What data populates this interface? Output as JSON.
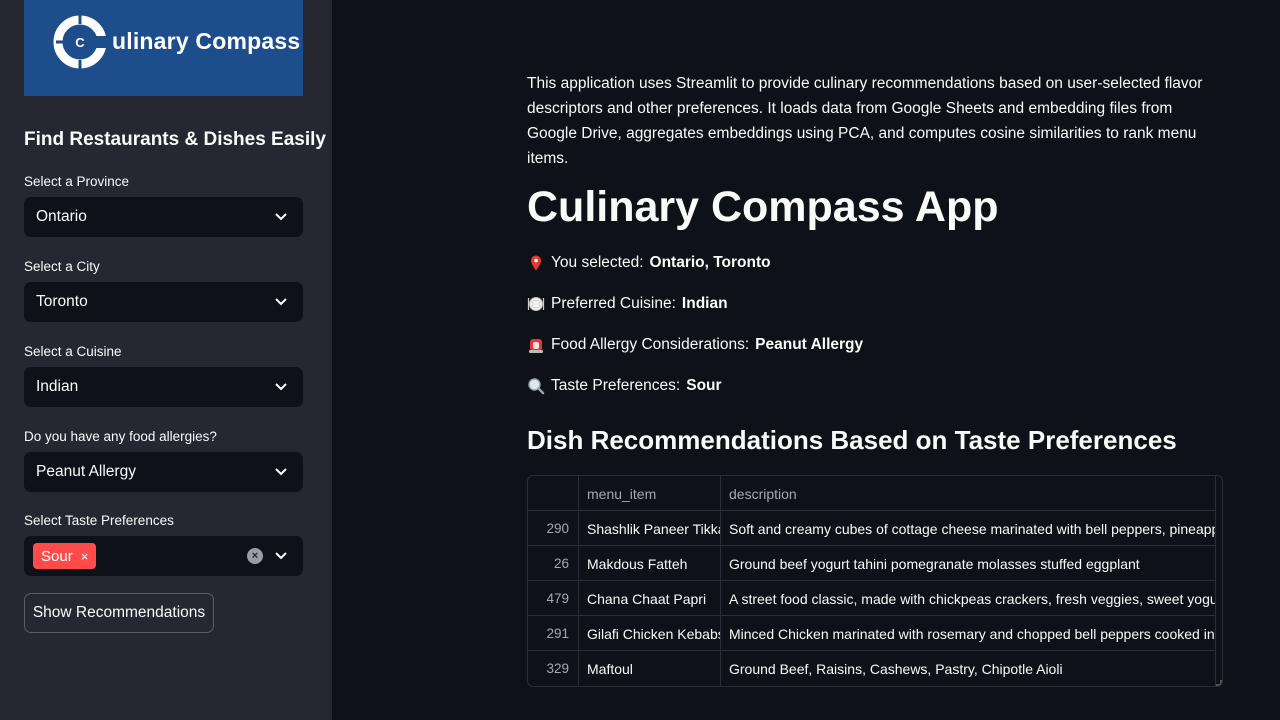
{
  "sidebar": {
    "logo_text": "ulinary Compass",
    "logo_mark_letter": "C",
    "heading": "Find Restaurants & Dishes Easily",
    "province": {
      "label": "Select a Province",
      "value": "Ontario"
    },
    "city": {
      "label": "Select a City",
      "value": "Toronto"
    },
    "cuisine": {
      "label": "Select a Cuisine",
      "value": "Indian"
    },
    "allergy": {
      "label": "Do you have any food allergies?",
      "value": "Peanut Allergy"
    },
    "taste": {
      "label": "Select Taste Preferences",
      "tags": [
        "Sour"
      ],
      "tag_remove": "×",
      "clear": "×"
    },
    "button_label": "Show Recommendations"
  },
  "main": {
    "intro": "This application uses Streamlit to provide culinary recommendations based on user-selected flavor descriptors and other preferences. It loads data from Google Sheets and embedding files from Google Drive, aggregates embeddings using PCA, and computes cosine similarities to rank menu items.",
    "title": "Culinary Compass App",
    "location": {
      "label": "You selected:",
      "value": "Ontario, Toronto",
      "icon": "pin-icon"
    },
    "cuisine": {
      "label": "Preferred Cuisine:",
      "value": "Indian",
      "icon": "plate-icon"
    },
    "allergy": {
      "label": "Food Allergy Considerations:",
      "value": "Peanut Allergy",
      "icon": "siren-icon"
    },
    "taste": {
      "label": "Taste Preferences:",
      "value": "Sour",
      "icon": "magnifier-icon"
    },
    "subtitle": "Dish Recommendations Based on Taste Preferences",
    "table": {
      "columns": [
        "",
        "menu_item",
        "description"
      ],
      "rows": [
        {
          "idx": "290",
          "menu_item": "Shashlik Paneer Tikka",
          "description": "Soft and creamy cubes of cottage cheese marinated with bell peppers, pineapples, or"
        },
        {
          "idx": "26",
          "menu_item": "Makdous Fatteh",
          "description": "Ground beef yogurt tahini pomegranate molasses stuffed eggplant"
        },
        {
          "idx": "479",
          "menu_item": "Chana Chaat Papri",
          "description": "A street food classic, made with chickpeas crackers, fresh veggies, sweet yogurt and t"
        },
        {
          "idx": "291",
          "menu_item": "Gilafi Chicken Kebabs",
          "description": "Minced Chicken marinated with rosemary and chopped bell peppers cooked in the cl"
        },
        {
          "idx": "329",
          "menu_item": "Maftoul",
          "description": "Ground Beef, Raisins, Cashews, Pastry, Chipotle Aioli"
        }
      ]
    }
  },
  "colors": {
    "accent": "#ff4b4b",
    "background": "#0e1117",
    "sidebar": "#262730",
    "logo_bg": "#1e4d8c"
  }
}
